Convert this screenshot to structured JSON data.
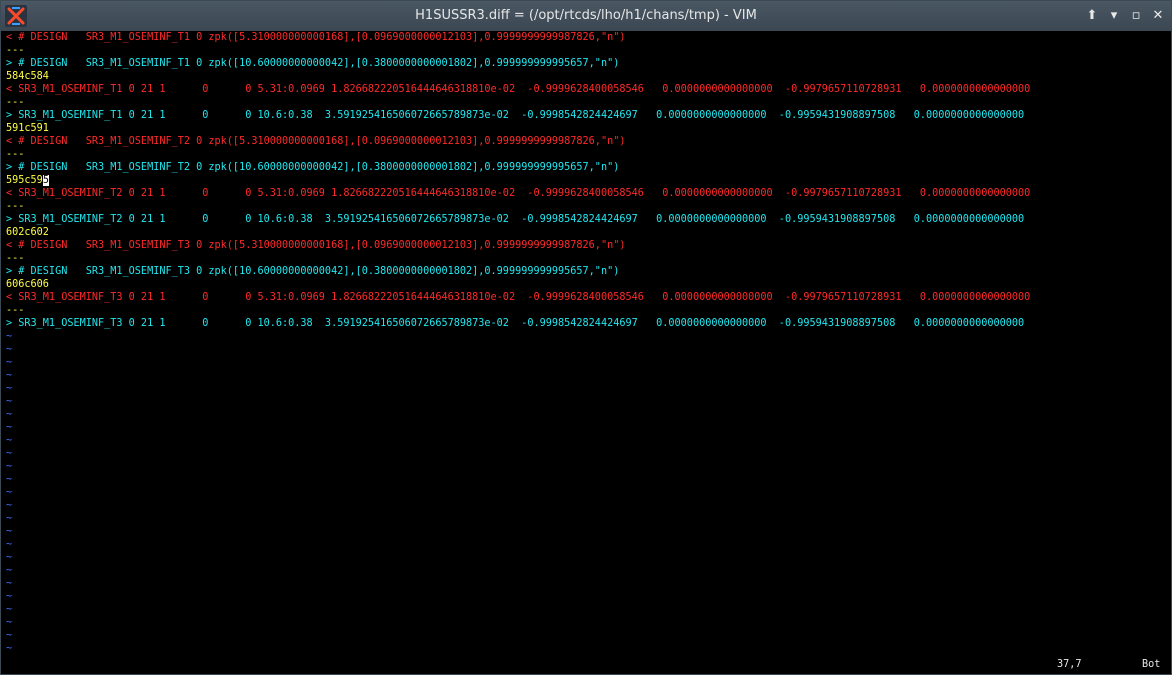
{
  "window": {
    "title": "H1SUSSR3.diff = (/opt/rtcds/lho/h1/chans/tmp) - VIM",
    "app_icon": "x-terminal-icon",
    "buttons": {
      "pin": "⬆",
      "minimize": "▾",
      "maximize": "▫",
      "close": "✕"
    }
  },
  "colors": {
    "removed": "#ff2a2a",
    "added": "#22e8f0",
    "hunk": "#ffff44",
    "tilde": "#3f6cff"
  },
  "lines": [
    {
      "text": "< # DESIGN   SR3_M1_OSEMINF_T1 0 zpk([5.310000000000168],[0.0969000000012103],0.9999999999987826,\"n\")",
      "color": "red"
    },
    {
      "text": "---",
      "color": "yellow"
    },
    {
      "text": "> # DESIGN   SR3_M1_OSEMINF_T1 0 zpk([10.60000000000042],[0.3800000000001802],0.999999999995657,\"n\")",
      "color": "cyan"
    },
    {
      "text": "584c584",
      "color": "yellow"
    },
    {
      "text": "< SR3_M1_OSEMINF_T1 0 21 1      0      0 5.31:0.0969 1.826682220516444646318810e-02  -0.9999628400058546   0.0000000000000000  -0.9979657110728931   0.0000000000000000",
      "color": "red"
    },
    {
      "text": "---",
      "color": "yellow"
    },
    {
      "text": "> SR3_M1_OSEMINF_T1 0 21 1      0      0 10.6:0.38  3.591925416506072665789873e-02  -0.9998542824424697   0.0000000000000000  -0.9959431908897508   0.0000000000000000",
      "color": "cyan"
    },
    {
      "text": "591c591",
      "color": "yellow"
    },
    {
      "text": "< # DESIGN   SR3_M1_OSEMINF_T2 0 zpk([5.310000000000168],[0.0969000000012103],0.9999999999987826,\"n\")",
      "color": "red"
    },
    {
      "text": "---",
      "color": "yellow"
    },
    {
      "text": "> # DESIGN   SR3_M1_OSEMINF_T2 0 zpk([10.60000000000042],[0.3800000000001802],0.999999999995657,\"n\")",
      "color": "cyan"
    },
    {
      "text": "595c595",
      "color": "yellow",
      "cursor": true
    },
    {
      "text": "< SR3_M1_OSEMINF_T2 0 21 1      0      0 5.31:0.0969 1.826682220516444646318810e-02  -0.9999628400058546   0.0000000000000000  -0.9979657110728931   0.0000000000000000",
      "color": "red"
    },
    {
      "text": "---",
      "color": "yellow"
    },
    {
      "text": "> SR3_M1_OSEMINF_T2 0 21 1      0      0 10.6:0.38  3.591925416506072665789873e-02  -0.9998542824424697   0.0000000000000000  -0.9959431908897508   0.0000000000000000",
      "color": "cyan"
    },
    {
      "text": "602c602",
      "color": "yellow"
    },
    {
      "text": "< # DESIGN   SR3_M1_OSEMINF_T3 0 zpk([5.310000000000168],[0.0969000000012103],0.9999999999987826,\"n\")",
      "color": "red"
    },
    {
      "text": "---",
      "color": "yellow"
    },
    {
      "text": "> # DESIGN   SR3_M1_OSEMINF_T3 0 zpk([10.60000000000042],[0.3800000000001802],0.999999999995657,\"n\")",
      "color": "cyan"
    },
    {
      "text": "606c606",
      "color": "yellow"
    },
    {
      "text": "< SR3_M1_OSEMINF_T3 0 21 1      0      0 5.31:0.0969 1.826682220516444646318810e-02  -0.9999628400058546   0.0000000000000000  -0.9979657110728931   0.0000000000000000",
      "color": "red"
    },
    {
      "text": "---",
      "color": "yellow"
    },
    {
      "text": "> SR3_M1_OSEMINF_T3 0 21 1      0      0 10.6:0.38  3.591925416506072665789873e-02  -0.9998542824424697   0.0000000000000000  -0.9959431908897508   0.0000000000000000",
      "color": "cyan"
    }
  ],
  "tilde_line": {
    "text": "~",
    "count": 25
  },
  "status": {
    "position": "37,7",
    "scroll": "Bot"
  }
}
